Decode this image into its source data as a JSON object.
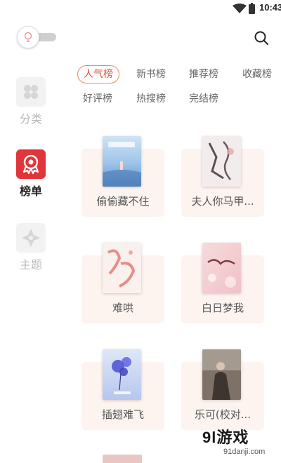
{
  "status_bar": {
    "time": "10:43"
  },
  "sidebar": {
    "items": [
      {
        "label": "分类",
        "icon": "category-icon",
        "active": false
      },
      {
        "label": "榜单",
        "icon": "ranking-icon",
        "active": true
      },
      {
        "label": "主题",
        "icon": "theme-icon",
        "active": false
      }
    ]
  },
  "rank_tabs": [
    {
      "label": "人气榜",
      "active": true
    },
    {
      "label": "新书榜",
      "active": false
    },
    {
      "label": "推荐榜",
      "active": false
    },
    {
      "label": "收藏榜",
      "active": false
    },
    {
      "label": "好评榜",
      "active": false
    },
    {
      "label": "热搜榜",
      "active": false
    },
    {
      "label": "完结榜",
      "active": false
    }
  ],
  "books": [
    {
      "title": "偷偷藏不住"
    },
    {
      "title": "夫人你马甲..."
    },
    {
      "title": "难哄"
    },
    {
      "title": "白日梦我"
    },
    {
      "title": "插翅难飞"
    },
    {
      "title": "乐可(校对..."
    }
  ],
  "watermark": {
    "brand": "9l游戏",
    "url": "91danji.com"
  },
  "colors": {
    "accent_red": "#e0353b",
    "tab_active_text": "#e0533b",
    "card_bg": "#fdf3ef"
  }
}
